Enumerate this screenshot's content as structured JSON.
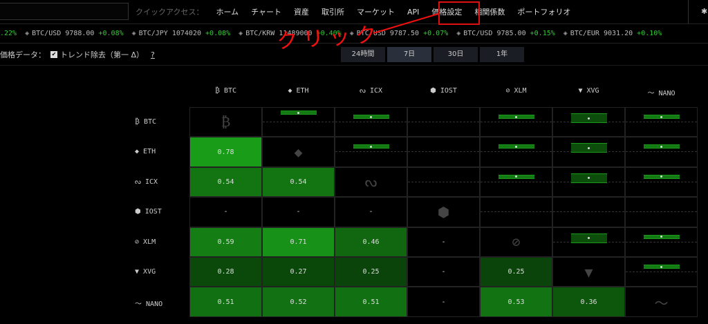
{
  "nav": {
    "quick_access_label": "クイックアクセス：",
    "items": [
      "ホーム",
      "チャート",
      "資産",
      "取引所",
      "マーケット",
      "API",
      "価格設定",
      "相関係数",
      "ポートフォリオ"
    ],
    "active": "相関係数"
  },
  "ticker": [
    {
      "icon": "coin-icon",
      "pair": "",
      "price": "",
      "change": ".22%"
    },
    {
      "icon": "exchange-icon",
      "pair": "BTC/USD",
      "price": "9788.00",
      "change": "+0.08%"
    },
    {
      "icon": "exchange-icon",
      "pair": "BTC/JPY",
      "price": "1074020",
      "change": "+0.08%"
    },
    {
      "icon": "exchange-icon",
      "pair": "BTC/KRW",
      "price": "11489000",
      "change": "+0.40%"
    },
    {
      "icon": "exchange-icon",
      "pair": "BTC/USD",
      "price": "9787.50",
      "change": "+0.07%"
    },
    {
      "icon": "exchange-icon",
      "pair": "BTC/USD",
      "price": "9785.00",
      "change": "+0.15%"
    },
    {
      "icon": "exchange-icon",
      "pair": "BTC/EUR",
      "price": "9031.20",
      "change": "+0.10%"
    }
  ],
  "options": {
    "label": "価格データ：",
    "checkbox_label": "トレンド除去（第一 Δ）",
    "checked": true,
    "help": "?"
  },
  "tabs": [
    "24時間",
    "7日",
    "30日",
    "1年"
  ],
  "active_tab": "7日",
  "annotation": "クリック",
  "coins": [
    {
      "sym": "BTC",
      "glyph": "₿"
    },
    {
      "sym": "ETH",
      "glyph": "◆"
    },
    {
      "sym": "ICX",
      "glyph": "ᔓ"
    },
    {
      "sym": "IOST",
      "glyph": "⬢"
    },
    {
      "sym": "XLM",
      "glyph": "⊘"
    },
    {
      "sym": "XVG",
      "glyph": "▼"
    },
    {
      "sym": "NANO",
      "glyph": "〜"
    }
  ],
  "matrix": [
    [
      null,
      null,
      null,
      null,
      null,
      null,
      null
    ],
    [
      "0.78",
      null,
      null,
      null,
      null,
      null,
      null
    ],
    [
      "0.54",
      "0.54",
      null,
      null,
      null,
      null,
      null
    ],
    [
      "-",
      "-",
      "-",
      null,
      null,
      null,
      null
    ],
    [
      "0.59",
      "0.71",
      "0.46",
      "-",
      null,
      null,
      null
    ],
    [
      "0.28",
      "0.27",
      "0.25",
      "-",
      "0.25",
      null,
      null
    ],
    [
      "0.51",
      "0.52",
      "0.51",
      "-",
      "0.53",
      "0.36",
      null
    ]
  ],
  "colors": {
    "accent": "#33cc33",
    "highlight": "#e01010"
  }
}
